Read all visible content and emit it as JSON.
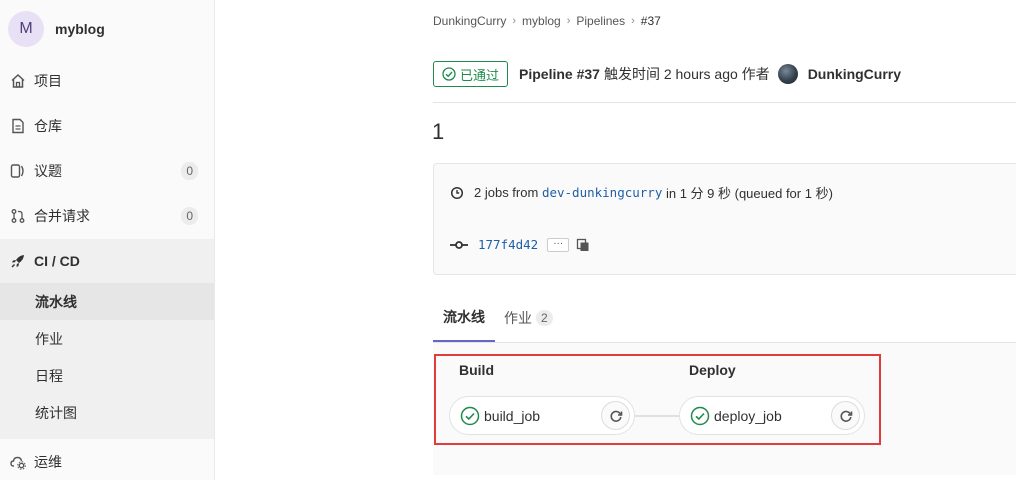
{
  "sidebar": {
    "project_initial": "M",
    "project_name": "myblog",
    "items": [
      {
        "label": "项目",
        "icon": "home-icon"
      },
      {
        "label": "仓库",
        "icon": "file-icon"
      },
      {
        "label": "议题",
        "icon": "issues-icon",
        "count": "0"
      },
      {
        "label": "合并请求",
        "icon": "merge-request-icon",
        "count": "0"
      },
      {
        "label": "CI / CD",
        "icon": "rocket-icon"
      },
      {
        "label": "运维",
        "icon": "cloud-gear-icon"
      }
    ],
    "cicd_subitems": [
      "流水线",
      "作业",
      "日程",
      "统计图"
    ]
  },
  "breadcrumb": [
    "DunkingCurry",
    "myblog",
    "Pipelines",
    "#37"
  ],
  "header": {
    "status": "已通过",
    "title": "Pipeline #37",
    "triggered_text": "触发时间 2 hours ago 作者",
    "user": "DunkingCurry"
  },
  "commit_title": "1",
  "info": {
    "jobs_text_pre": "2 jobs from",
    "branch": "dev-dunkingcurry",
    "jobs_text_post": "in 1 分 9 秒 (queued for 1 秒)",
    "sha": "177f4d42",
    "ellipsis": "···"
  },
  "tabs": [
    {
      "label": "流水线"
    },
    {
      "label": "作业",
      "count": "2"
    }
  ],
  "stages": [
    {
      "title": "Build",
      "job": "build_job"
    },
    {
      "title": "Deploy",
      "job": "deploy_job"
    }
  ],
  "colors": {
    "success": "#1f8a4c",
    "highlight": "#e23b3b",
    "tab_underline": "#6666c4"
  }
}
